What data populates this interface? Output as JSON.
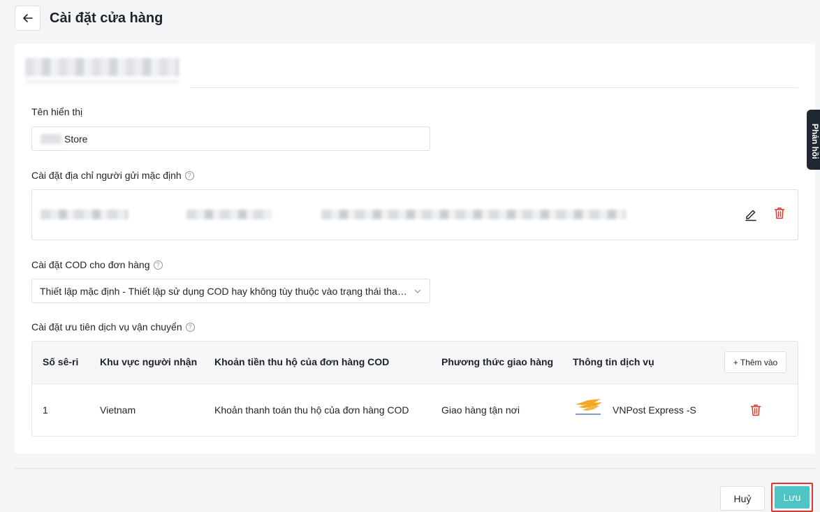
{
  "header": {
    "title": "Cài đặt cửa hàng",
    "back_icon": "arrow-left-icon"
  },
  "form": {
    "display_name_label": "Tên hiển thị",
    "display_name_value": "Store",
    "sender_address_label": "Cài đặt địa chỉ người gửi mặc định",
    "cod_label": "Cài đặt COD cho đơn hàng",
    "cod_value": "Thiết lập mặc định - Thiết lập sử dụng COD hay không tùy thuộc vào trạng thái thanh toán",
    "shipping_priority_label": "Cài đặt ưu tiên dịch vụ vận chuyển"
  },
  "table": {
    "headers": [
      "Số sê-ri",
      "Khu vực người nhận",
      "Khoản tiền thu hộ của đơn hàng COD",
      "Phương thức giao hàng",
      "Thông tin dịch vụ"
    ],
    "add_button": "+ Thêm vào",
    "rows": [
      {
        "serial": "1",
        "region": "Vietnam",
        "cod_amount": "Khoản thanh toán thu hộ của đơn hàng COD",
        "delivery_method": "Giao hàng tận nơi",
        "service": "VNPost Express -S"
      }
    ]
  },
  "footer": {
    "cancel_label": "Huỷ",
    "save_label": "Lưu"
  },
  "side_tab": {
    "label": "Phản hồi"
  },
  "colors": {
    "accent": "#4fc4c4",
    "danger": "#e0362c",
    "highlight_border": "#e0362c"
  }
}
